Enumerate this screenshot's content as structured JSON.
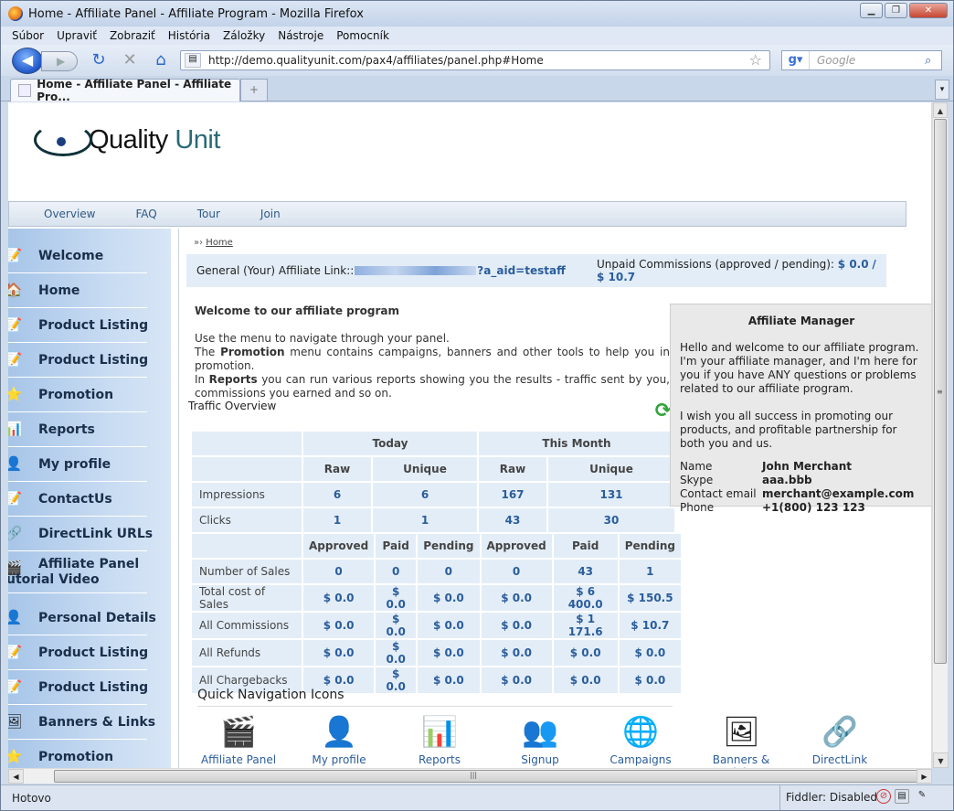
{
  "browser": {
    "title": "Home - Affiliate Panel - Affiliate Program - Mozilla Firefox",
    "menu": [
      "Súbor",
      "Upraviť",
      "Zobraziť",
      "História",
      "Záložky",
      "Nástroje",
      "Pomocník"
    ],
    "url": "http://demo.qualityunit.com/pax4/affiliates/panel.php#Home",
    "search_placeholder": "Google",
    "tab_title": "Home - Affiliate Panel - Affiliate Pro...",
    "status": "Hotovo",
    "fiddler": "Fiddler: Disabled"
  },
  "logo": {
    "part1": "Quality",
    "part2": "Unit"
  },
  "topnav": [
    "Overview",
    "FAQ",
    "Tour",
    "Join"
  ],
  "sidebar": [
    {
      "label": "Welcome",
      "icon": "note-icon"
    },
    {
      "label": "Home",
      "icon": "home-icon"
    },
    {
      "label": "Product Listing",
      "icon": "note-icon"
    },
    {
      "label": "Product Listing",
      "icon": "note-icon"
    },
    {
      "label": "Promotion",
      "icon": "star-icon"
    },
    {
      "label": "Reports",
      "icon": "chart-icon"
    },
    {
      "label": "My profile",
      "icon": "person-icon"
    },
    {
      "label": "ContactUs",
      "icon": "note-icon"
    },
    {
      "label": "DirectLink URLs",
      "icon": "link-icon"
    },
    {
      "label": "Affiliate Panel",
      "label2": "utorial Video",
      "icon": "clapper-icon"
    },
    {
      "label": "Personal Details",
      "icon": "person-edit-icon"
    },
    {
      "label": "Product Listing",
      "icon": "note-icon"
    },
    {
      "label": "Product Listing",
      "icon": "note-icon"
    },
    {
      "label": "Banners & Links",
      "icon": "banner-icon"
    },
    {
      "label": "Promotion",
      "icon": "star-icon"
    }
  ],
  "breadcrumb": "Home",
  "affiliate_link": {
    "label": "General (Your) Affiliate Link::",
    "suffix": "?a_aid=testaff",
    "unpaid_label": "Unpaid Commissions (approved / pending):",
    "approved": "$ 0.0",
    "sep": "/",
    "pending": "$ 10.7"
  },
  "welcome": {
    "title": "Welcome to our affiliate program",
    "line1": "Use the menu to navigate through your panel.",
    "line2a": "The ",
    "line2b": "Promotion",
    "line2c": " menu contains campaigns, banners and other tools to help you in promotion.",
    "line3a": "In ",
    "line3b": "Reports",
    "line3c": " you can run various reports showing you the results - traffic sent by you, commissions you earned and so on."
  },
  "traffic": {
    "title": "Traffic Overview",
    "today": "Today",
    "month": "This Month",
    "raw": "Raw",
    "unique": "Unique",
    "rows1": [
      {
        "label": "Impressions",
        "v": [
          "6",
          "6",
          "167",
          "131"
        ]
      },
      {
        "label": "Clicks",
        "v": [
          "1",
          "1",
          "43",
          "30"
        ]
      }
    ],
    "cols2": [
      "Approved",
      "Paid",
      "Pending",
      "Approved",
      "Paid",
      "Pending"
    ],
    "rows2": [
      {
        "label": "Number of Sales",
        "v": [
          "0",
          "0",
          "0",
          "0",
          "43",
          "1"
        ]
      },
      {
        "label": "Total cost of Sales",
        "v": [
          "$ 0.0",
          "$ 0.0",
          "$ 0.0",
          "$ 0.0",
          "$ 6 400.0",
          "$ 150.5"
        ]
      },
      {
        "label": "All Commissions",
        "v": [
          "$ 0.0",
          "$ 0.0",
          "$ 0.0",
          "$ 0.0",
          "$ 1 171.6",
          "$ 10.7"
        ]
      },
      {
        "label": "All Refunds",
        "v": [
          "$ 0.0",
          "$ 0.0",
          "$ 0.0",
          "$ 0.0",
          "$ 0.0",
          "$ 0.0"
        ]
      },
      {
        "label": "All Chargebacks",
        "v": [
          "$ 0.0",
          "$ 0.0",
          "$ 0.0",
          "$ 0.0",
          "$ 0.0",
          "$ 0.0"
        ]
      }
    ]
  },
  "quick_nav": {
    "title": "Quick Navigation Icons",
    "items": [
      {
        "label": "Affiliate Panel",
        "icon": "clapper-icon"
      },
      {
        "label": "My profile",
        "icon": "person-icon"
      },
      {
        "label": "Reports",
        "icon": "chart-icon"
      },
      {
        "label": "Signup",
        "icon": "add-user-icon"
      },
      {
        "label": "Campaigns",
        "icon": "globe-icon"
      },
      {
        "label": "Banners & Links",
        "icon": "banner-icon"
      },
      {
        "label": "DirectLink URLs",
        "icon": "link-icon"
      }
    ]
  },
  "manager": {
    "title": "Affiliate Manager",
    "p1": "Hello and welcome to our affiliate program. I'm your affiliate manager, and I'm here for you if you have ANY questions or problems related to our affiliate program.",
    "p2": "I wish you all success in promoting our products, and profitable partnership for both you and us.",
    "fields": [
      {
        "k": "Name",
        "v": "John Merchant"
      },
      {
        "k": "Skype",
        "v": "aaa.bbb"
      },
      {
        "k": "Contact email",
        "v": "merchant@example.com"
      },
      {
        "k": "Phone",
        "v": "+1(800) 123 123"
      }
    ]
  }
}
